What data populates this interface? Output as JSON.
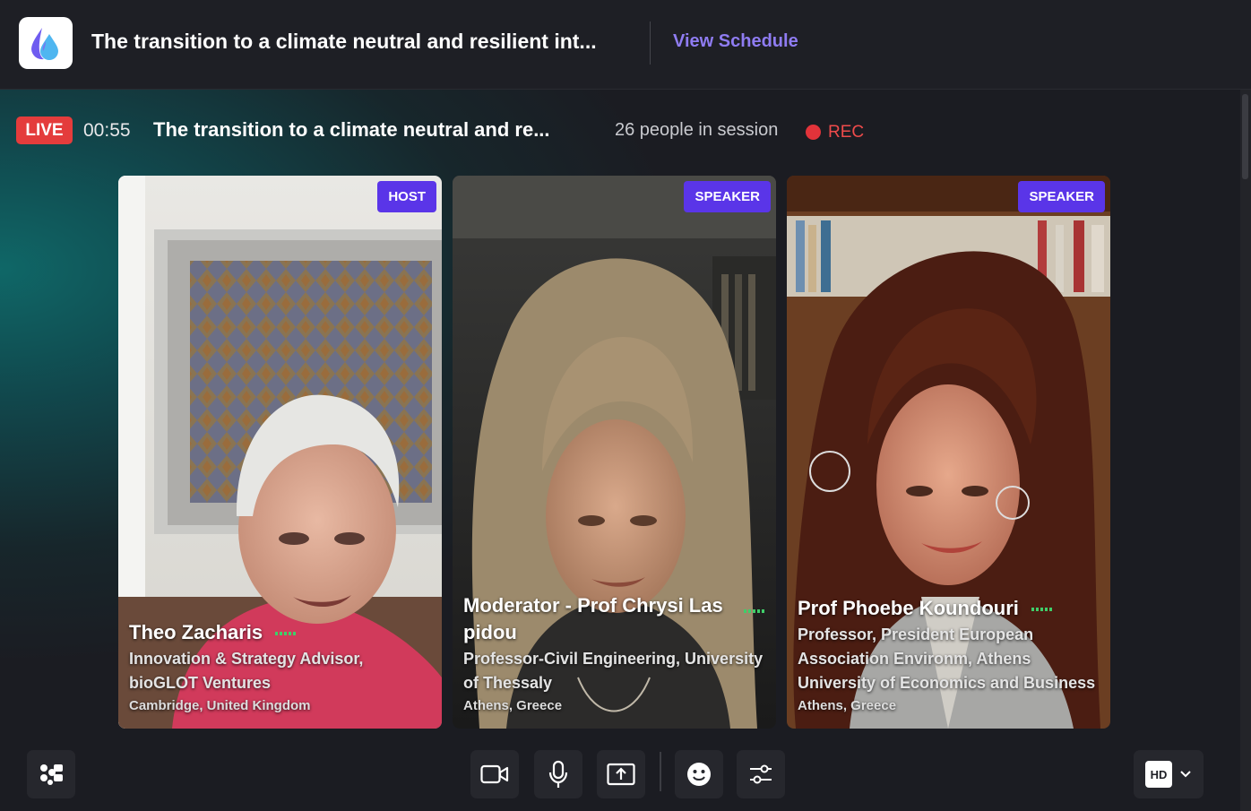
{
  "header": {
    "event_title": "The transition to a climate neutral and resilient int...",
    "view_schedule_label": "View Schedule"
  },
  "session": {
    "live_label": "LIVE",
    "timer": "00:55",
    "title": "The transition to a climate neutral and re...",
    "people_count": "26 people in session",
    "rec_label": "REC"
  },
  "participants": [
    {
      "role": "HOST",
      "name": "Theo Zacharis",
      "title": "Innovation & Strategy Advisor, bioGLOT Ventures",
      "location": "Cambridge, United Kingdom"
    },
    {
      "role": "SPEAKER",
      "name": "Moderator - Prof Chrysi Las pidou",
      "title": "Professor-Civil Engineering, University of Thessaly",
      "location": "Athens, Greece"
    },
    {
      "role": "SPEAKER",
      "name": "Prof Phoebe Koundouri",
      "title": "Professor, President European Association Environm, Athens University of Economics and Business",
      "location": "Athens, Greece"
    }
  ],
  "controls": {
    "quality_label": "HD"
  },
  "colors": {
    "accent": "#8f7cf2",
    "badge": "#5a35e8",
    "live": "#e43c3c",
    "audio": "#3fce6a"
  }
}
